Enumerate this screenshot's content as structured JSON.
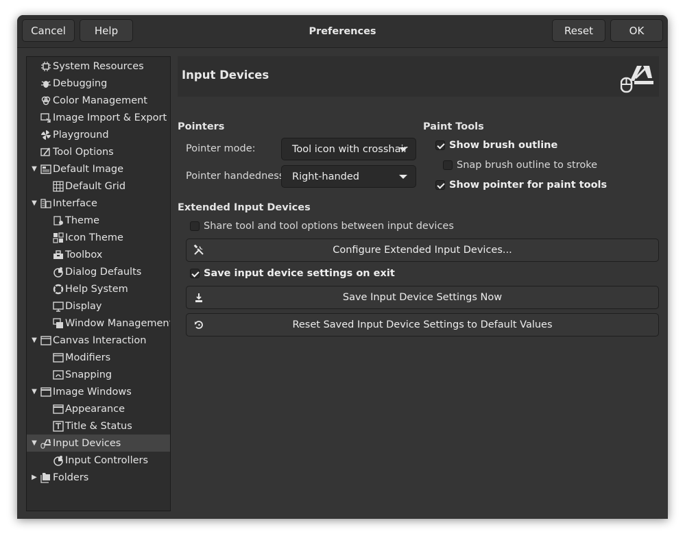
{
  "window": {
    "title": "Preferences",
    "buttons": {
      "cancel": "Cancel",
      "help": "Help",
      "reset": "Reset",
      "ok": "OK"
    }
  },
  "sidebar": {
    "items": [
      {
        "label": "System Resources",
        "level": 0,
        "expander": "none",
        "icon": "chip-icon"
      },
      {
        "label": "Debugging",
        "level": 0,
        "expander": "none",
        "icon": "bug-icon"
      },
      {
        "label": "Color Management",
        "level": 0,
        "expander": "none",
        "icon": "color-circles-icon"
      },
      {
        "label": "Image Import & Export",
        "level": 0,
        "expander": "none",
        "icon": "import-export-icon"
      },
      {
        "label": "Playground",
        "level": 0,
        "expander": "none",
        "icon": "pinwheel-icon"
      },
      {
        "label": "Tool Options",
        "level": 0,
        "expander": "none",
        "icon": "tool-options-icon"
      },
      {
        "label": "Default Image",
        "level": 0,
        "expander": "expanded",
        "icon": "image-icon"
      },
      {
        "label": "Default Grid",
        "level": 1,
        "expander": "none",
        "icon": "grid-icon"
      },
      {
        "label": "Interface",
        "level": 0,
        "expander": "expanded",
        "icon": "interface-icon"
      },
      {
        "label": "Theme",
        "level": 1,
        "expander": "none",
        "icon": "theme-icon"
      },
      {
        "label": "Icon Theme",
        "level": 1,
        "expander": "none",
        "icon": "icon-theme-icon"
      },
      {
        "label": "Toolbox",
        "level": 1,
        "expander": "none",
        "icon": "toolbox-icon"
      },
      {
        "label": "Dialog Defaults",
        "level": 1,
        "expander": "none",
        "icon": "dialog-defaults-icon"
      },
      {
        "label": "Help System",
        "level": 1,
        "expander": "none",
        "icon": "lifebuoy-icon"
      },
      {
        "label": "Display",
        "level": 1,
        "expander": "none",
        "icon": "monitor-icon"
      },
      {
        "label": "Window Management",
        "level": 1,
        "expander": "none",
        "icon": "windows-icon"
      },
      {
        "label": "Canvas Interaction",
        "level": 0,
        "expander": "expanded",
        "icon": "canvas-icon"
      },
      {
        "label": "Modifiers",
        "level": 1,
        "expander": "none",
        "icon": "canvas-icon"
      },
      {
        "label": "Snapping",
        "level": 1,
        "expander": "none",
        "icon": "snapping-icon"
      },
      {
        "label": "Image Windows",
        "level": 0,
        "expander": "expanded",
        "icon": "window-icon"
      },
      {
        "label": "Appearance",
        "level": 1,
        "expander": "none",
        "icon": "window-icon"
      },
      {
        "label": "Title & Status",
        "level": 1,
        "expander": "none",
        "icon": "title-status-icon"
      },
      {
        "label": "Input Devices",
        "level": 0,
        "expander": "expanded",
        "icon": "input-devices-icon",
        "selected": true
      },
      {
        "label": "Input Controllers",
        "level": 1,
        "expander": "none",
        "icon": "dialog-defaults-icon"
      },
      {
        "label": "Folders",
        "level": 0,
        "expander": "collapsed",
        "icon": "folders-icon"
      }
    ]
  },
  "page": {
    "title": "Input Devices",
    "icon": "input-devices-icon",
    "pointers": {
      "title": "Pointers",
      "mode_label": "Pointer mode:",
      "mode_value": "Tool icon with crosshair",
      "handedness_label": "Pointer handedness:",
      "handedness_value": "Right-handed"
    },
    "paint_tools": {
      "title": "Paint Tools",
      "show_brush_outline": {
        "label": "Show brush outline",
        "checked": true
      },
      "snap_brush_outline": {
        "label": "Snap brush outline to stroke",
        "checked": false
      },
      "show_pointer": {
        "label": "Show pointer for paint tools",
        "checked": true
      }
    },
    "extended": {
      "title": "Extended Input Devices",
      "share_tool": {
        "label": "Share tool and tool options between input devices",
        "checked": false
      },
      "configure_button": "Configure Extended Input Devices...",
      "save_on_exit": {
        "label": "Save input device settings on exit",
        "checked": true
      },
      "save_now_button": "Save Input Device Settings Now",
      "reset_button": "Reset Saved Input Device Settings to Default Values"
    }
  }
}
